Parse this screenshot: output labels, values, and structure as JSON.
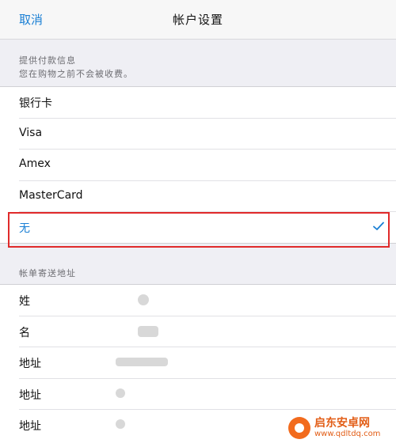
{
  "navbar": {
    "cancel": "取消",
    "title": "帐户设置"
  },
  "payment": {
    "header_line1": "提供付款信息",
    "header_line2": "您在购物之前不会被收费。",
    "options": [
      {
        "label": "银行卡",
        "selected": false
      },
      {
        "label": "Visa",
        "selected": false
      },
      {
        "label": "Amex",
        "selected": false
      },
      {
        "label": "MasterCard",
        "selected": false
      },
      {
        "label": "无",
        "selected": true
      }
    ],
    "check_icon": "checkmark-icon",
    "accent": "#1a7fd4",
    "highlight_color": "#e02a2a"
  },
  "billing": {
    "header": "帐单寄送地址",
    "fields": [
      {
        "label": "姓"
      },
      {
        "label": "名"
      },
      {
        "label": "地址"
      },
      {
        "label": "地址"
      },
      {
        "label": "地址"
      }
    ]
  },
  "watermark": {
    "name": "启东安卓网",
    "url": "www.qdltdq.com"
  }
}
